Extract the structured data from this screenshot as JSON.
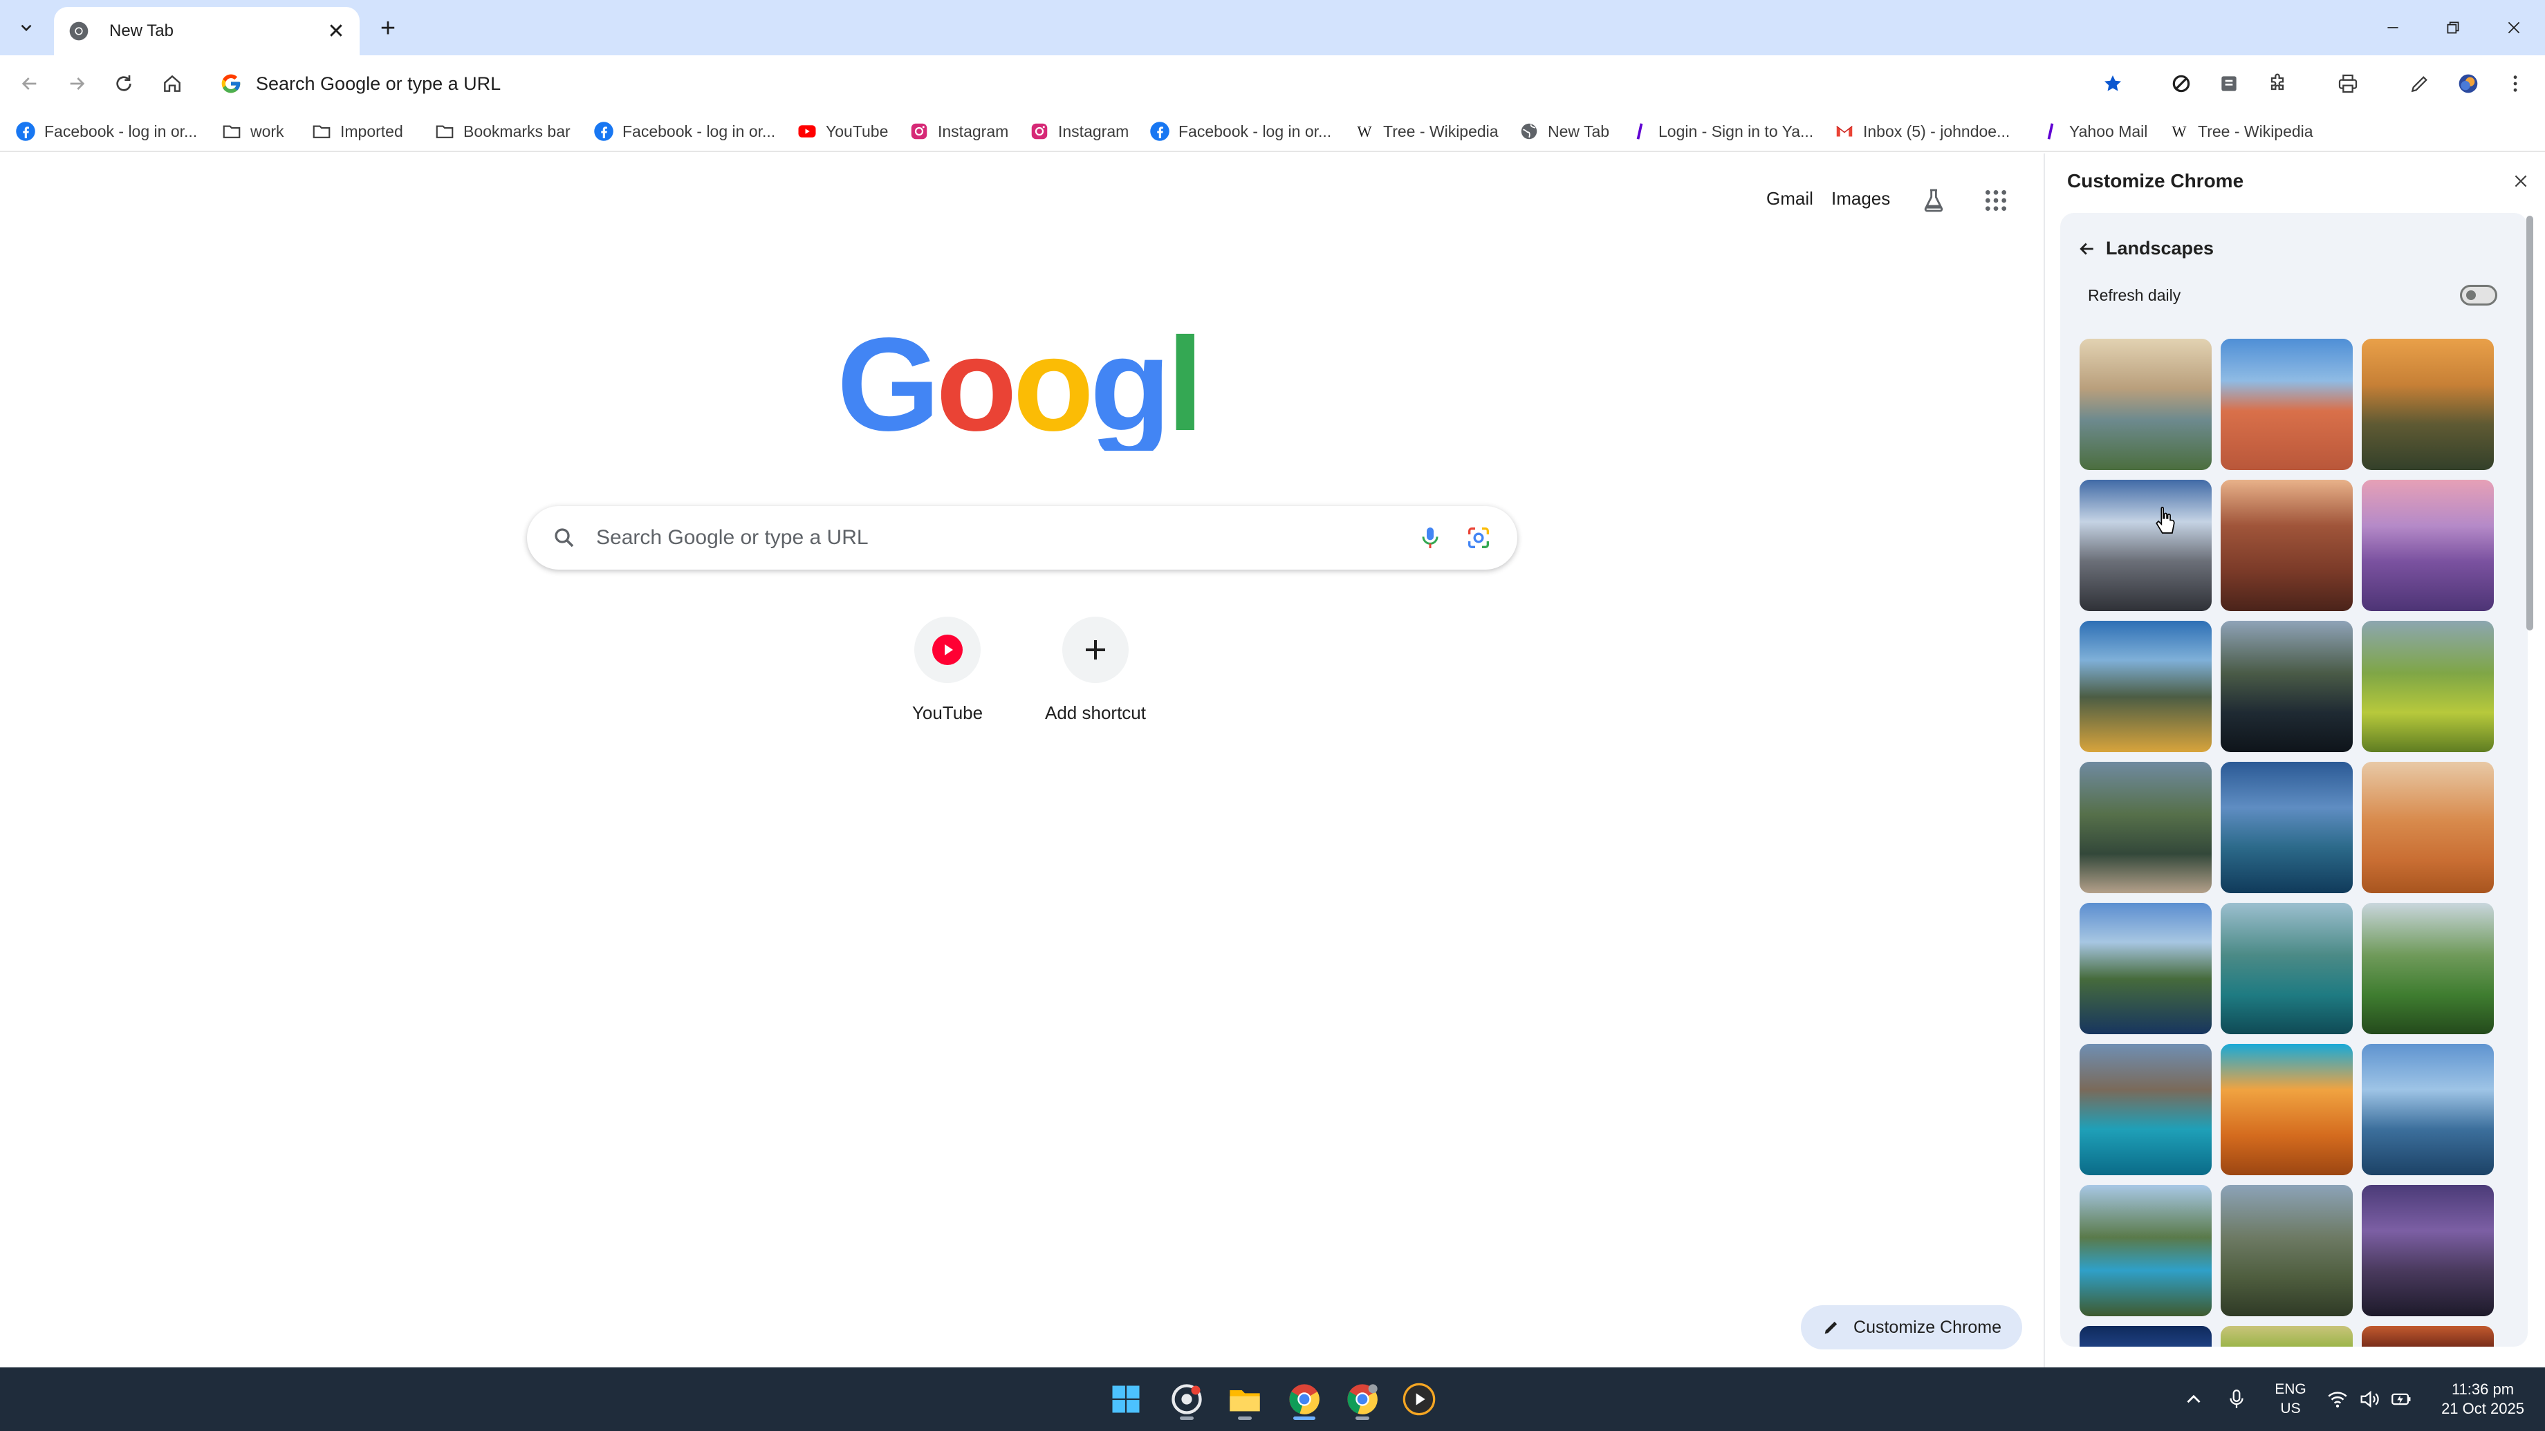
{
  "browser": {
    "tab": {
      "title": "New Tab",
      "close": "✕"
    },
    "new_tab": "+",
    "omnibox": {
      "text": "Search Google or type a URL"
    }
  },
  "bookmarks": [
    {
      "label": "Facebook - log in or...",
      "icon": "facebook-icon"
    },
    {
      "label": "work",
      "icon": "folder-icon"
    },
    {
      "label": "Imported",
      "icon": "folder-icon"
    },
    {
      "label": "Bookmarks bar",
      "icon": "folder-icon"
    },
    {
      "label": "Facebook - log in or...",
      "icon": "facebook-icon"
    },
    {
      "label": "YouTube",
      "icon": "youtube-icon"
    },
    {
      "label": "Instagram",
      "icon": "instagram-icon"
    },
    {
      "label": "Instagram",
      "icon": "instagram-icon"
    },
    {
      "label": "Facebook - log in or...",
      "icon": "facebook-icon"
    },
    {
      "label": "Tree - Wikipedia",
      "icon": "wikipedia-icon"
    },
    {
      "label": "New Tab",
      "icon": "globe-icon"
    },
    {
      "label": "Login - Sign in to Ya...",
      "icon": "yahoo-icon"
    },
    {
      "label": "Inbox (5) - johndoe...",
      "icon": "gmail-icon"
    },
    {
      "label": "Yahoo Mail",
      "icon": "yahoo-icon"
    },
    {
      "label": "Tree - Wikipedia",
      "icon": "wikipedia-icon"
    }
  ],
  "ntp": {
    "top_links": {
      "gmail": "Gmail",
      "images": "Images"
    },
    "search_placeholder": "Search Google or type a URL",
    "shortcuts": [
      {
        "label": "YouTube",
        "icon": "youtube-icon"
      },
      {
        "label": "Add shortcut",
        "icon": "plus-icon"
      }
    ],
    "customize_button": "Customize Chrome"
  },
  "side_panel": {
    "title": "Customize Chrome",
    "section": "Landscapes",
    "refresh_daily": {
      "label": "Refresh daily",
      "enabled": false
    },
    "thumbnails": [
      {
        "name": "coastal-rock-pools"
      },
      {
        "name": "desert-stone-arch"
      },
      {
        "name": "golden-cliffs"
      },
      {
        "name": "snowy-mountain-peaks"
      },
      {
        "name": "red-rock-canyon"
      },
      {
        "name": "lavender-field-tree"
      },
      {
        "name": "volcano-sunrise"
      },
      {
        "name": "mountain-lake-reflection"
      },
      {
        "name": "green-rice-terraces"
      },
      {
        "name": "stone-bridge-river"
      },
      {
        "name": "alpine-lake-peaks"
      },
      {
        "name": "sand-dunes"
      },
      {
        "name": "sea-cliffs"
      },
      {
        "name": "turquoise-lagoon"
      },
      {
        "name": "green-valley-waterfall"
      },
      {
        "name": "island-bay"
      },
      {
        "name": "orange-desert-dunes"
      },
      {
        "name": "calm-lake-boat"
      },
      {
        "name": "turquoise-mountain-lake"
      },
      {
        "name": "mountain-ruins"
      },
      {
        "name": "purple-rocky-shore"
      },
      {
        "name": "night-sky"
      },
      {
        "name": "green-hills"
      },
      {
        "name": "red-canyon"
      }
    ]
  },
  "taskbar": {
    "lang": {
      "line1": "ENG",
      "line2": "US"
    },
    "clock": {
      "time": "11:36 pm",
      "date": "21 Oct 2025"
    }
  },
  "colors": {
    "tabstrip": "#d3e3fd",
    "bookmark_star": "#0b57d0",
    "google_blue": "#4285F4",
    "google_red": "#EA4335",
    "google_yellow": "#FBBC05",
    "google_green": "#34A853",
    "youtube_red": "#FF0000"
  }
}
